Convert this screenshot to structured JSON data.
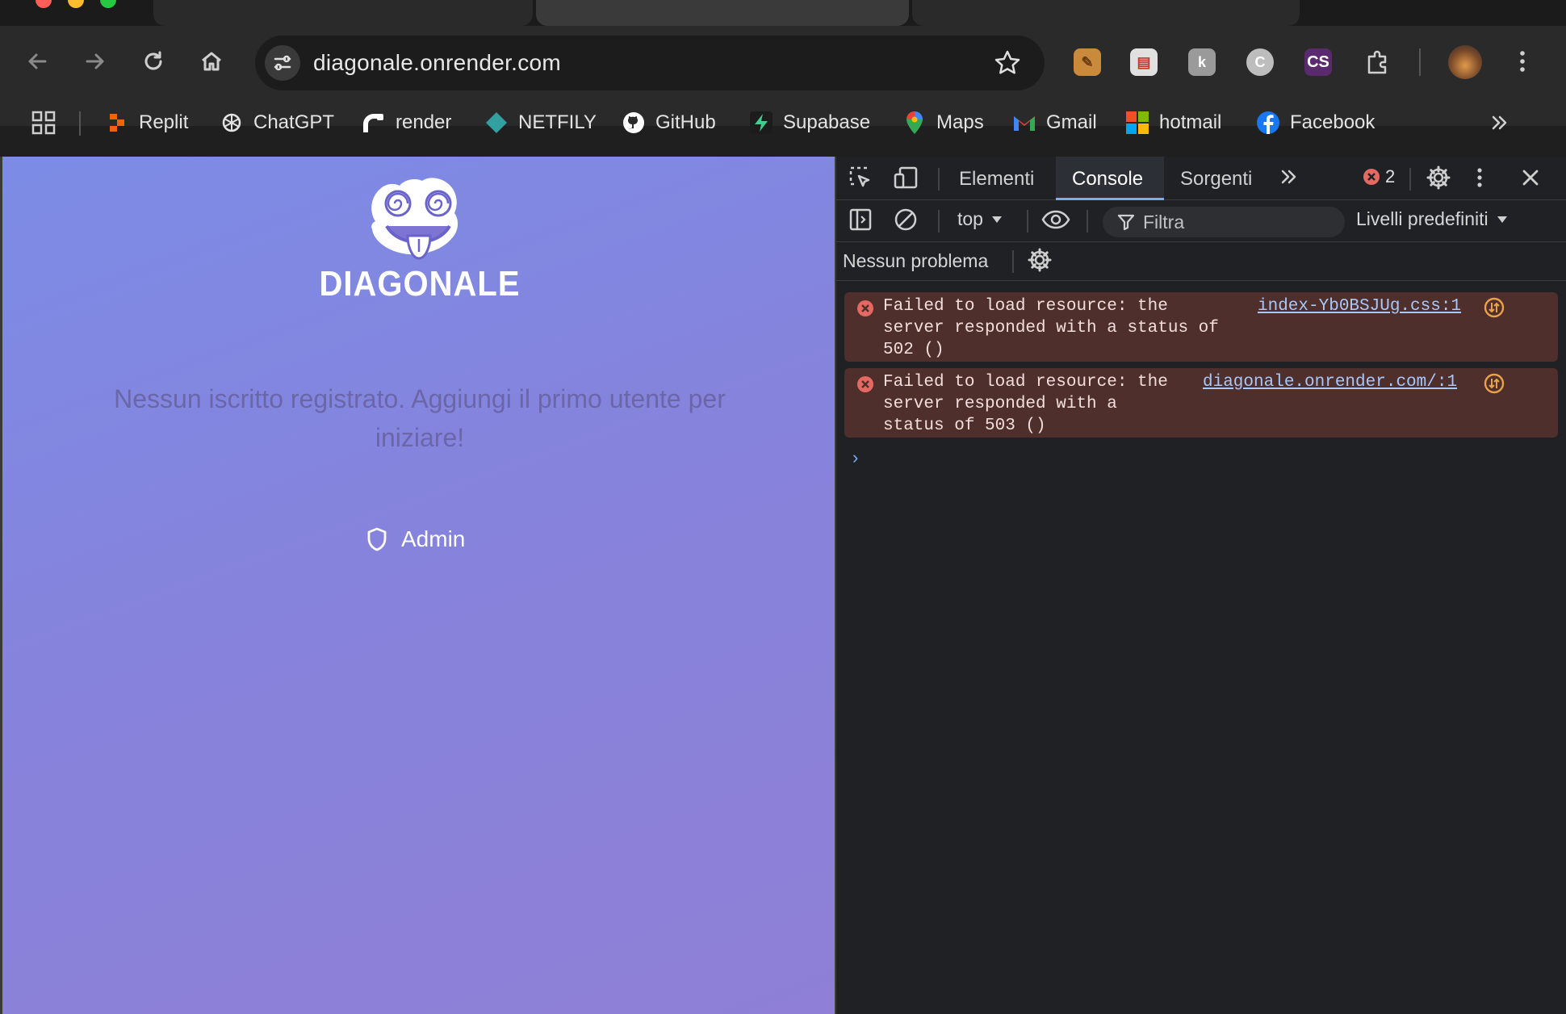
{
  "browser": {
    "url": "diagonale.onrender.com",
    "bookmarks": [
      {
        "label": "Replit",
        "icon": "replit-icon"
      },
      {
        "label": "ChatGPT",
        "icon": "chatgpt-icon"
      },
      {
        "label": "render",
        "icon": "render-icon"
      },
      {
        "label": "NETFILY",
        "icon": "netlify-icon"
      },
      {
        "label": "GitHub",
        "icon": "github-icon"
      },
      {
        "label": "Supabase",
        "icon": "supabase-icon"
      },
      {
        "label": "Maps",
        "icon": "maps-icon"
      },
      {
        "label": "Gmail",
        "icon": "gmail-icon"
      },
      {
        "label": "hotmail",
        "icon": "microsoft-icon"
      },
      {
        "label": "Facebook",
        "icon": "facebook-icon"
      }
    ],
    "extensions": {
      "cs_label": "CS"
    }
  },
  "page": {
    "logo_text": "DIAGONALE",
    "empty_message": "Nessun iscritto registrato. Aggiungi il primo utente per iniziare!",
    "admin_label": "Admin"
  },
  "devtools": {
    "tabs": [
      "Elementi",
      "Console",
      "Sorgenti"
    ],
    "active_tab": "Console",
    "error_count": "2",
    "context": "top",
    "filter_placeholder": "Filtra",
    "levels": "Livelli predefiniti",
    "issues": "Nessun problema",
    "messages": [
      {
        "text": "Failed to load resource: the\nserver responded with a status of\n502 ()",
        "source": "index-Yb0BSJUg.css:1"
      },
      {
        "text": "Failed to load resource: the\nserver responded with a\nstatus of 503 ()",
        "source": "diagonale.onrender.com/:1"
      }
    ],
    "prompt": "›"
  },
  "colors": {
    "page_gradient_start": "#7c8ce6",
    "page_gradient_end": "#8f7fd6",
    "error_row_bg": "#4e2f2b",
    "link": "#a8c7fa",
    "active_tab_underline": "#7cacf8"
  }
}
